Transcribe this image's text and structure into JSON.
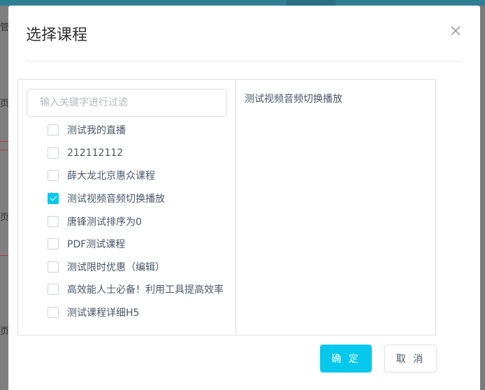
{
  "background": {
    "side_chars": [
      "管",
      "页",
      "页",
      "页"
    ]
  },
  "dialog": {
    "title": "选择课程",
    "filter": {
      "placeholder": "输入关键字进行过滤",
      "value": ""
    },
    "courses": [
      {
        "label": "测试我的直播",
        "checked": false
      },
      {
        "label": "212112112",
        "checked": false
      },
      {
        "label": "薛大龙北京惠众课程",
        "checked": false
      },
      {
        "label": "测试视频音频切换播放",
        "checked": true
      },
      {
        "label": "唐锋测试排序为0",
        "checked": false
      },
      {
        "label": "PDF测试课程",
        "checked": false
      },
      {
        "label": "测试限时优惠（编辑）",
        "checked": false
      },
      {
        "label": "高效能人士必备！利用工具提高效率",
        "checked": false
      },
      {
        "label": "测试课程详细H5",
        "checked": false
      }
    ],
    "selected": [
      "测试视频音频切换播放"
    ],
    "buttons": {
      "confirm": "确 定",
      "cancel": "取 消"
    }
  },
  "colors": {
    "accent": "#06c8ec",
    "text": "#48576a",
    "border": "#dcdfe6"
  }
}
